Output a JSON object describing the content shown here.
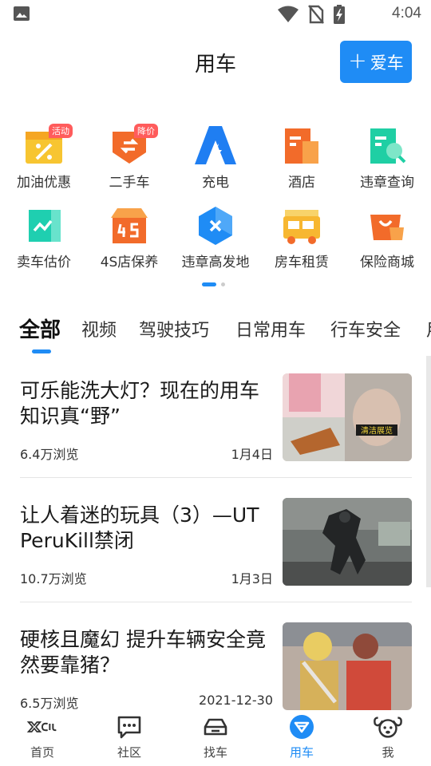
{
  "status_bar": {
    "time": "4:04",
    "icons": [
      "picture-icon",
      "wifi-icon",
      "no-sim-icon",
      "battery-charging-icon"
    ]
  },
  "header": {
    "title": "用车",
    "add_button_label": "爱车"
  },
  "services": [
    {
      "label": "加油优惠",
      "icon": "fuel-coupon-icon",
      "tag": "活动",
      "color": "#f7c531"
    },
    {
      "label": "二手车",
      "icon": "used-car-icon",
      "tag": "降价",
      "color": "#f26b2a"
    },
    {
      "label": "充电",
      "icon": "charging-icon",
      "tag": "",
      "color": "#1f7ef2"
    },
    {
      "label": "酒店",
      "icon": "hotel-icon",
      "tag": "",
      "color": "#f26b2a"
    },
    {
      "label": "违章查询",
      "icon": "violation-query-icon",
      "tag": "",
      "color": "#1fcfa4"
    },
    {
      "label": "卖车估价",
      "icon": "sell-car-estimate-icon",
      "tag": "",
      "color": "#1fcfb0"
    },
    {
      "label": "4S店保养",
      "icon": "4s-maintenance-icon",
      "tag": "",
      "color": "#f26b2a"
    },
    {
      "label": "违章高发地",
      "icon": "violation-hotspot-icon",
      "tag": "",
      "color": "#1f8cf5"
    },
    {
      "label": "房车租赁",
      "icon": "rv-rental-icon",
      "tag": "",
      "color": "#f7b731"
    },
    {
      "label": "保险商城",
      "icon": "insurance-mall-icon",
      "tag": "",
      "color": "#f26b2a"
    }
  ],
  "pager": {
    "pages": 2,
    "current": 1
  },
  "tabs": [
    "全部",
    "视频",
    "驾驶技巧",
    "日常用车",
    "行车安全",
    "用"
  ],
  "articles": [
    {
      "title": "可乐能洗大灯？现在的用车知识真“野”",
      "views": "6.4万浏览",
      "date": "1月4日",
      "thumb_caption": "清洁展览"
    },
    {
      "title": "让人着迷的玩具（3）—UT PeruKill禁闭",
      "views": "10.7万浏览",
      "date": "1月3日",
      "thumb_caption": ""
    },
    {
      "title": "硬核且魔幻 提升车辆安全竟然要靠猪？",
      "views": "6.5万浏览",
      "date": "2021-12-30",
      "thumb_caption": ""
    }
  ],
  "bottom_nav": [
    {
      "label": "首页",
      "icon": "home-logo-icon",
      "active": false
    },
    {
      "label": "社区",
      "icon": "community-icon",
      "active": false
    },
    {
      "label": "找车",
      "icon": "find-car-icon",
      "active": false
    },
    {
      "label": "用车",
      "icon": "use-car-icon",
      "active": true
    },
    {
      "label": "我",
      "icon": "profile-icon",
      "active": false
    }
  ],
  "colors": {
    "accent": "#1f8cf5",
    "tag": "#ff5c5c"
  }
}
